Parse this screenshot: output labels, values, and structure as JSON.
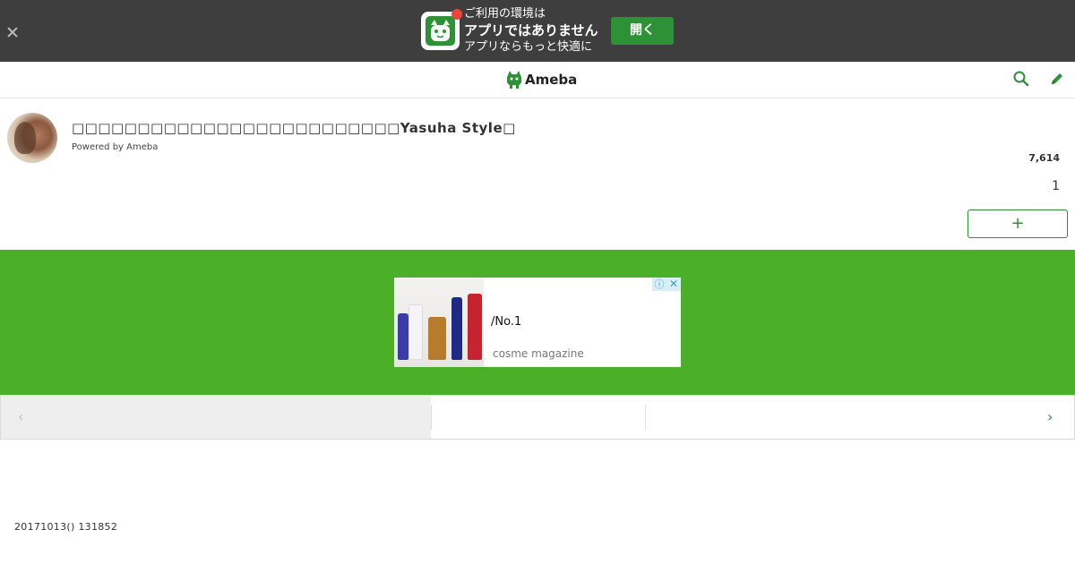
{
  "app_banner": {
    "close_icon": "close-icon",
    "app_icon": "ameba-app-icon",
    "line1": "ご利用の環境は",
    "line2": "アプリではありません",
    "line3": "アプリならもっと快適に",
    "open_label": "開く"
  },
  "header": {
    "logo_text": "Ameba",
    "search_icon": "search-icon",
    "edit_icon": "pencil-icon"
  },
  "profile": {
    "blog_title": "□□□□□□□□□□□□□□□□□□□□□□□□□Yasuha Style□",
    "powered_by": "Powered by Ameba",
    "reader_count": "7,614",
    "page_number": "1",
    "follow_label": "+"
  },
  "ad": {
    "title": "/No.1",
    "source": "cosme magazine",
    "info_label": "ⓘ",
    "close_label": "✕"
  },
  "pager": {
    "prev_label": "‹",
    "next_label": "›"
  },
  "footer": {
    "date_text": "20171013() 131852"
  },
  "colors": {
    "banner_bg": "#3e3e3e",
    "brand_green": "#2d9135",
    "ad_zone_green": "#4caf28"
  }
}
